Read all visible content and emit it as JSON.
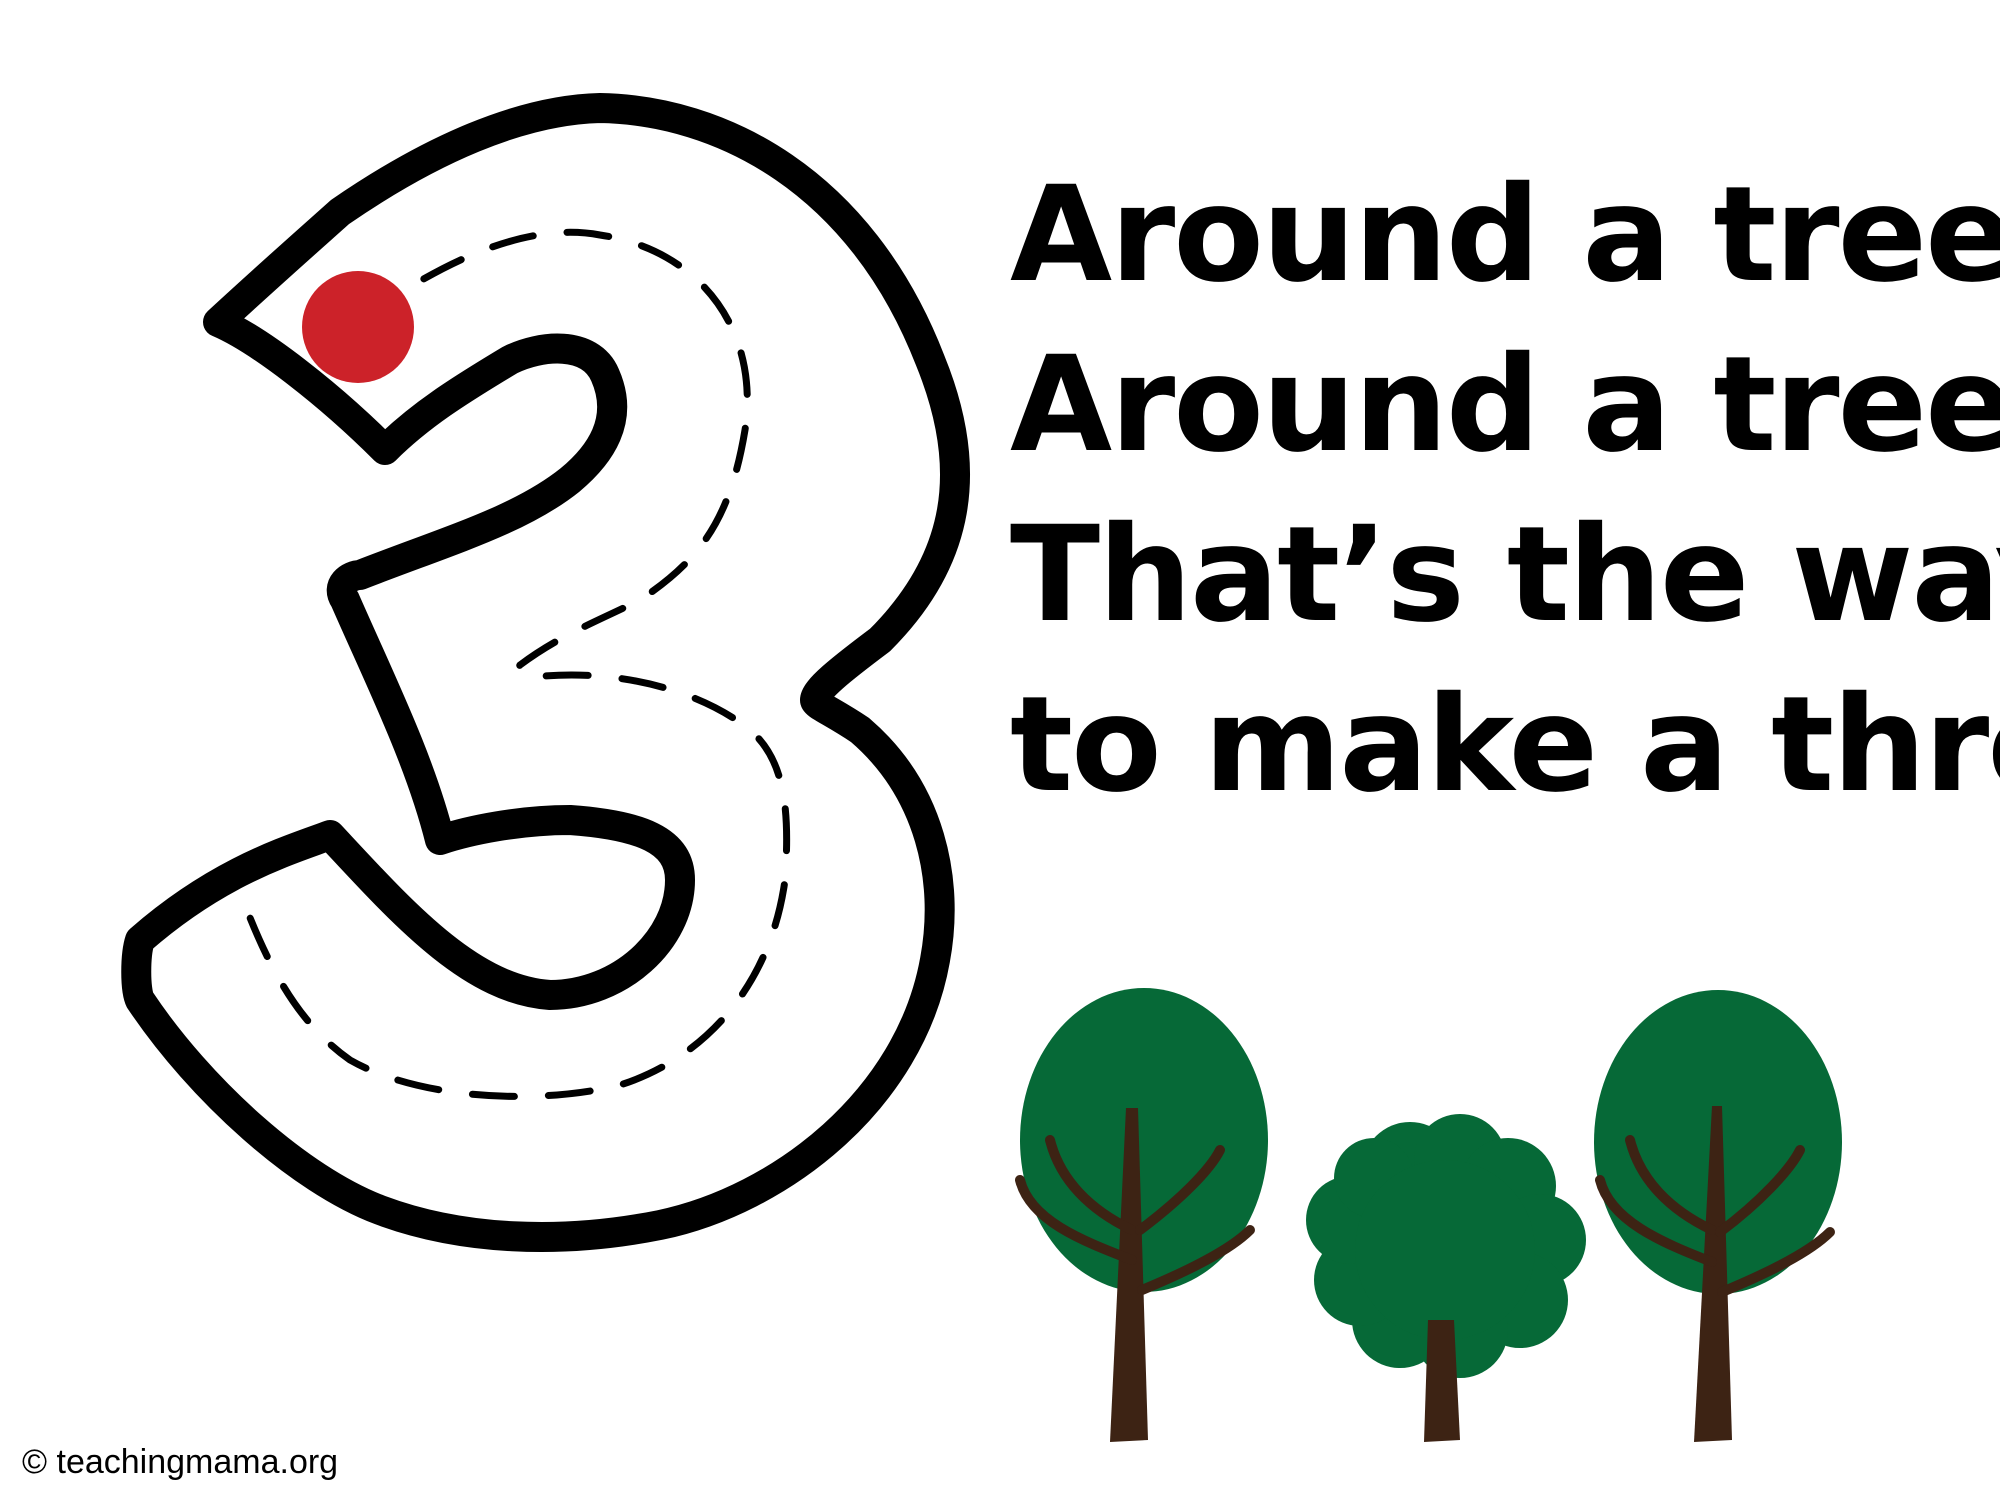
{
  "rhyme": {
    "lines": [
      "Around a tree,",
      "Around a tree.",
      "That’s the way",
      "to make a three!"
    ]
  },
  "numeral": {
    "value": "3",
    "start_dot_color": "#cc2229"
  },
  "trees": {
    "foliage_color": "#066937",
    "trunk_color": "#3d2314"
  },
  "footer": {
    "copyright": "© teachingmama.org"
  }
}
